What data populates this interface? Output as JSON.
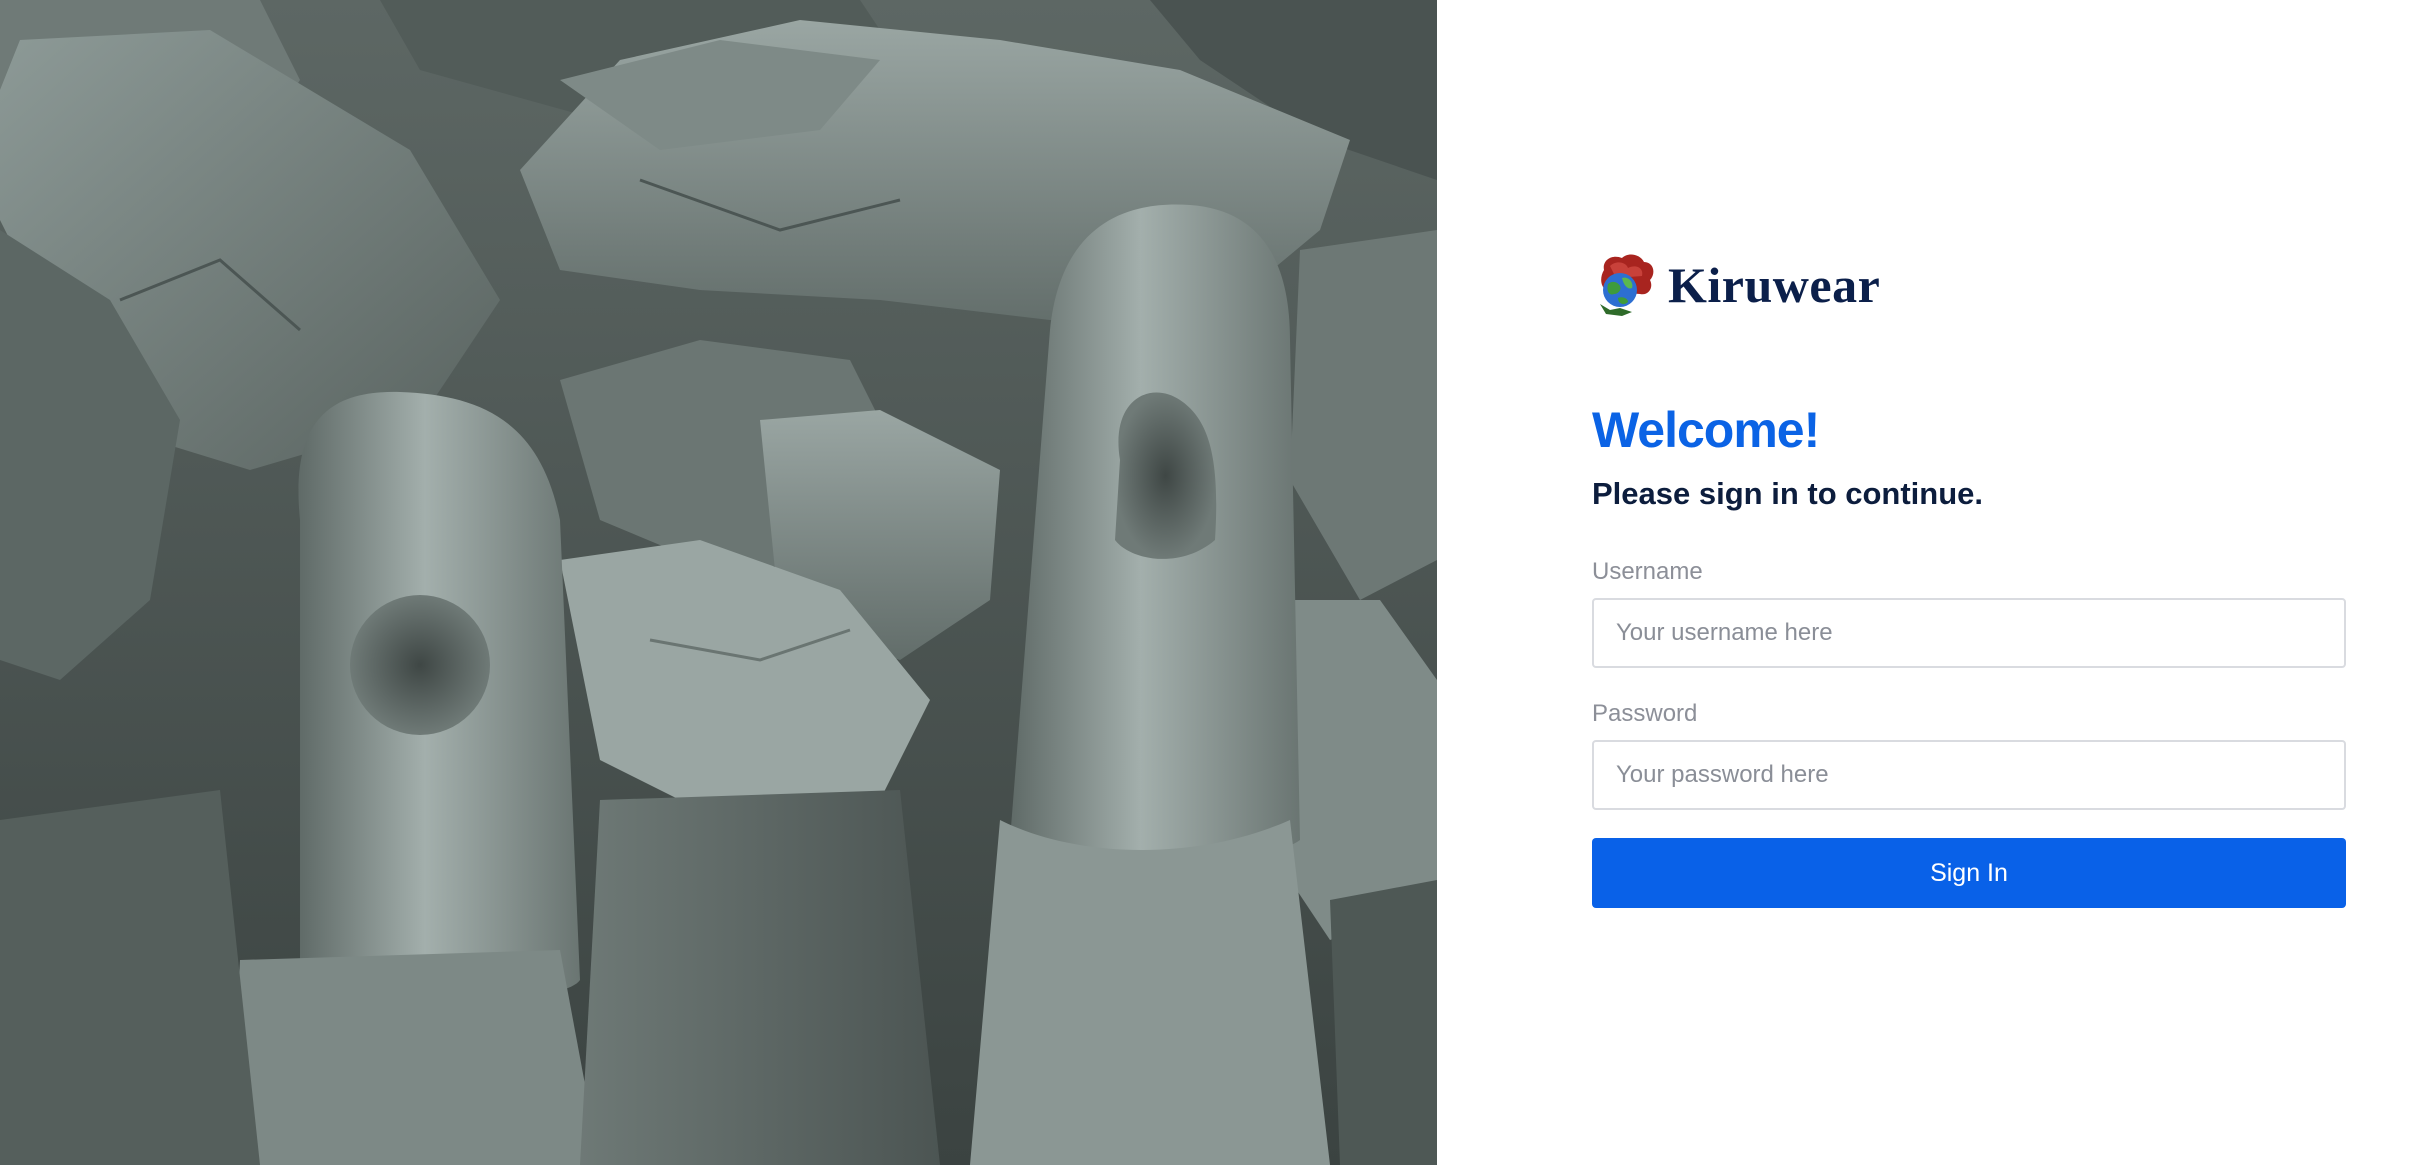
{
  "brand": {
    "name": "Kiruwear",
    "logo_icon": "globe-emblem-icon",
    "name_color": "#0b1f4a"
  },
  "hero": {
    "image_subject": "grayscale-stone-rocks-photo"
  },
  "login": {
    "heading": "Welcome!",
    "subheading": "Please sign in to continue.",
    "username_label": "Username",
    "username_placeholder": "Your username here",
    "username_value": "",
    "password_label": "Password",
    "password_placeholder": "Your password here",
    "password_value": "",
    "submit_label": "Sign In"
  },
  "colors": {
    "accent": "#0961e8",
    "heading": "#0b63e5",
    "subheading": "#0c1d3d",
    "label": "#8c8f98",
    "input_border": "#d9dbe0"
  }
}
